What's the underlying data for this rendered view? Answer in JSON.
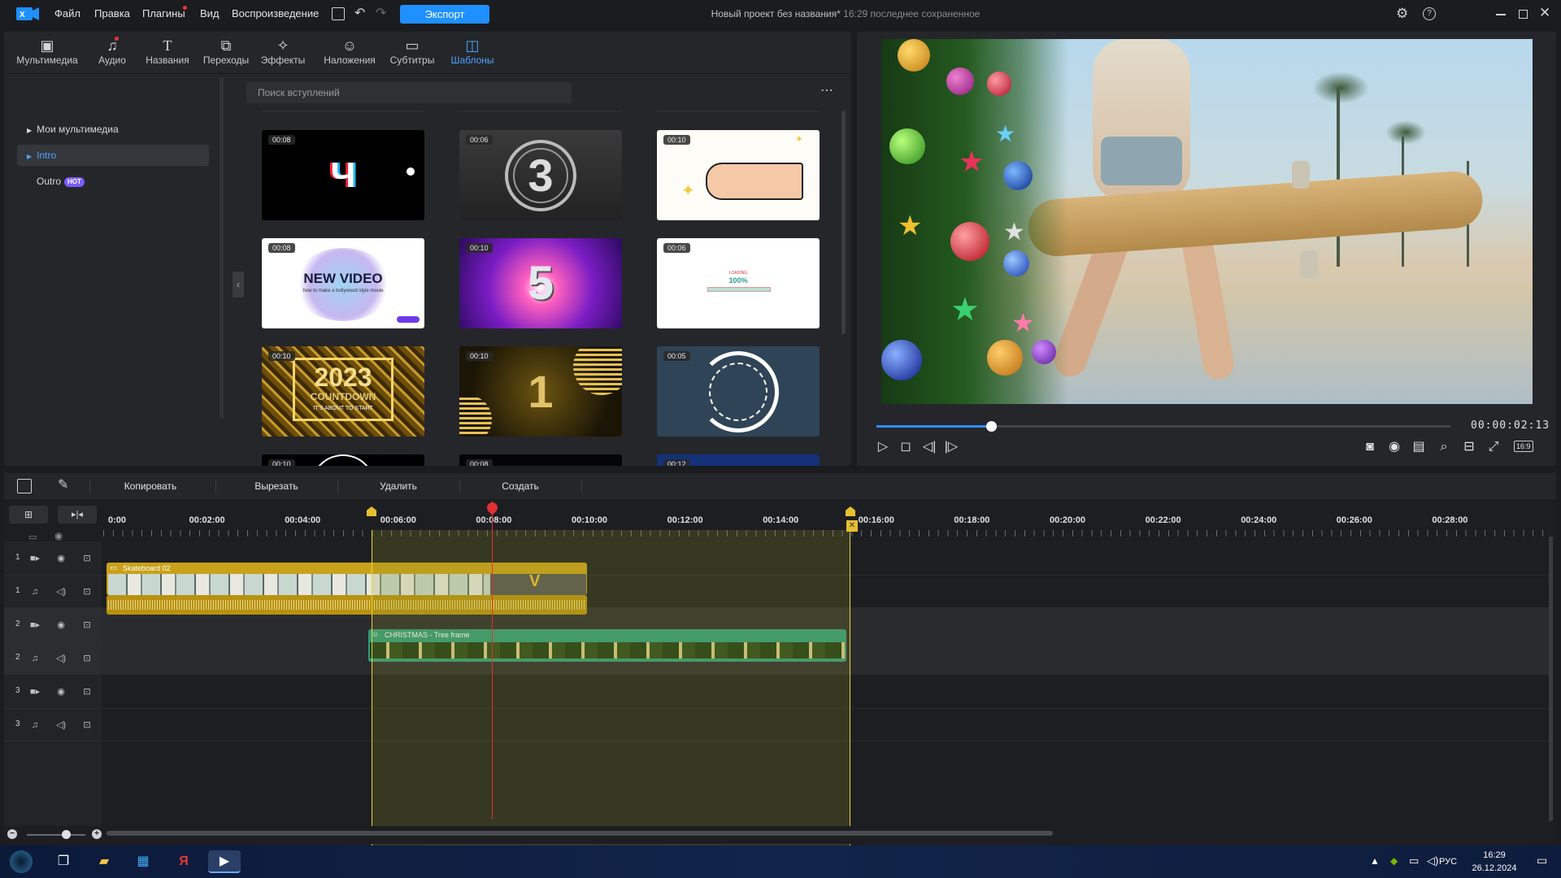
{
  "menu": {
    "items": [
      "Файл",
      "Правка",
      "Плагины",
      "Вид",
      "Воспроизведение"
    ],
    "export_label": "Экспорт"
  },
  "window": {
    "project_title": "Новый проект без названия*",
    "saved_note": "16:29 последнее сохраненное"
  },
  "tabs": [
    "Мультимедиа",
    "Аудио",
    "Названия",
    "Переходы",
    "Эффекты",
    "Наложения",
    "Субтитры",
    "Шаблоны"
  ],
  "tree": {
    "items": [
      "Мои мультимедиа",
      "Intro",
      "Outro"
    ],
    "hot_badge": "HOT"
  },
  "search": {
    "placeholder": "Поиск вступлений"
  },
  "templates": [
    {
      "duration": "00:08",
      "text": "Ч"
    },
    {
      "duration": "00:06",
      "text": "3"
    },
    {
      "duration": "00:10",
      "text": ""
    },
    {
      "duration": "00:08",
      "text": "NEW VIDEO",
      "subtext": "how to make a bollywood style movie"
    },
    {
      "duration": "00:10",
      "text": "5"
    },
    {
      "duration": "00:06",
      "text": "100%",
      "subtext": "LOADING"
    },
    {
      "duration": "00:10",
      "text": "2023",
      "subtext": "COUNTDOWN",
      "caption": "IT'S ABOUT TO START"
    },
    {
      "duration": "00:10",
      "text": "1"
    },
    {
      "duration": "00:05",
      "text": ""
    },
    {
      "duration": "00:10",
      "text": ""
    },
    {
      "duration": "00:08",
      "text": ""
    },
    {
      "duration": "00:12",
      "text": ""
    }
  ],
  "preview": {
    "timecode": "00:00:02:13",
    "progress": 0.2,
    "ratio": "16:9"
  },
  "timeline_toolbar": {
    "copy": "Копировать",
    "cut": "Вырезать",
    "delete": "Удалить",
    "create": "Создать"
  },
  "ruler_labels": [
    "0:00",
    "00:02:00",
    "00:04:00",
    "00:06:00",
    "00:08:00",
    "00:10:00",
    "00:12:00",
    "00:14:00",
    "00:16:00",
    "00:18:00",
    "00:20:00",
    "00:22:00",
    "00:24:00",
    "00:26:00",
    "00:28:00"
  ],
  "tracks": [
    {
      "num": "1",
      "kind": "video"
    },
    {
      "num": "1",
      "kind": "audio"
    },
    {
      "num": "2",
      "kind": "video"
    },
    {
      "num": "2",
      "kind": "audio"
    },
    {
      "num": "3",
      "kind": "video"
    },
    {
      "num": "3",
      "kind": "audio"
    }
  ],
  "clips": {
    "skateboard": "Skateboard 02",
    "christmas": "CHRISTMAS - Tree frame"
  },
  "taskbar": {
    "lang": "РУС",
    "time": "16:29",
    "date": "26.12.2024"
  },
  "colors": {
    "accent": "#1e90ff",
    "clip_video": "#c9a21a",
    "clip_overlay": "#2f9b7c",
    "playhead": "#e03030"
  }
}
